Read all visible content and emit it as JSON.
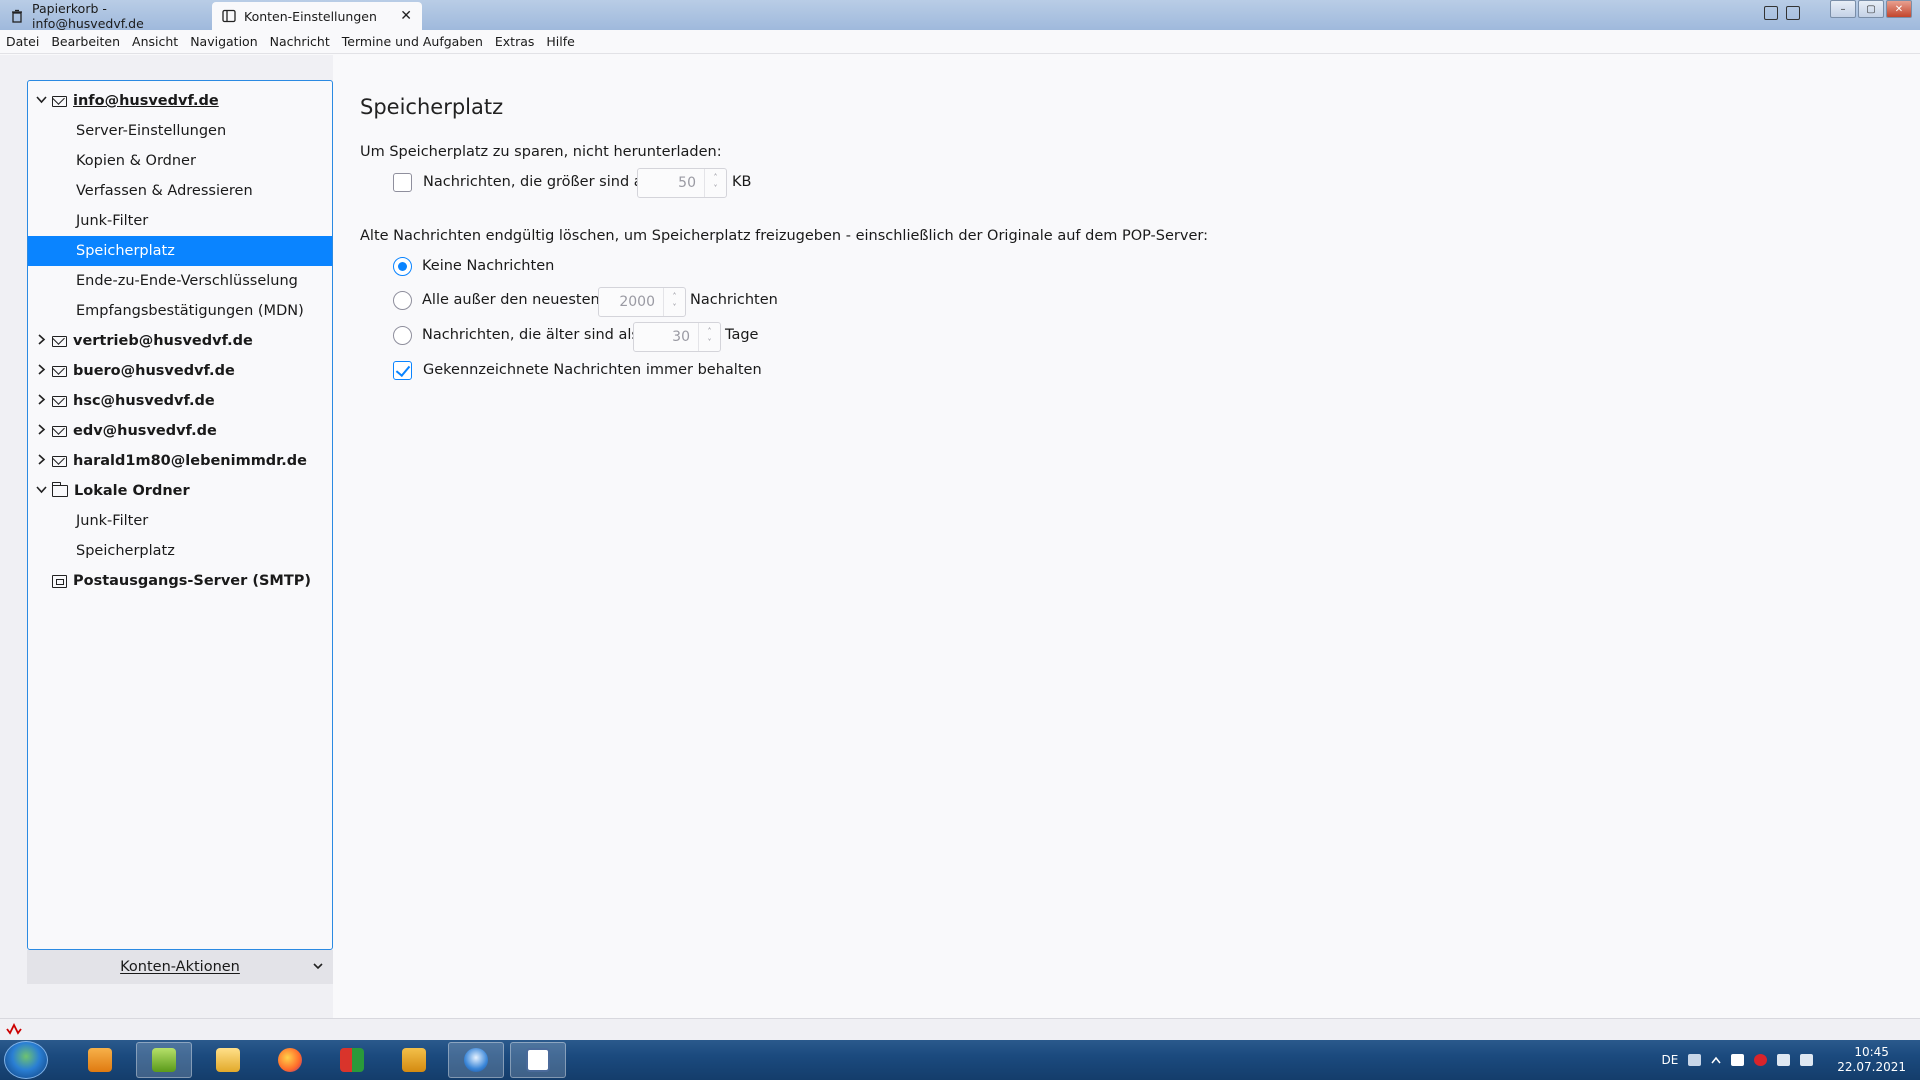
{
  "tabs": [
    {
      "label": "Papierkorb - info@husvedvf.de",
      "icon": "trash-icon"
    },
    {
      "label": "Konten-Einstellungen",
      "icon": "settings-tab-icon",
      "close": "✕"
    }
  ],
  "menu": [
    "Datei",
    "Bearbeiten",
    "Ansicht",
    "Navigation",
    "Nachricht",
    "Termine und Aufgaben",
    "Extras",
    "Hilfe"
  ],
  "tree": {
    "accounts": [
      {
        "label": "info@husvedvf.de",
        "expanded": true,
        "icon": "envelope-icon",
        "children": [
          "Server-Einstellungen",
          "Kopien & Ordner",
          "Verfassen & Adressieren",
          "Junk-Filter",
          "Speicherplatz",
          "Ende-zu-Ende-Verschlüsselung",
          "Empfangsbestätigungen (MDN)"
        ],
        "selected_child": "Speicherplatz"
      },
      {
        "label": "vertrieb@husvedvf.de",
        "expanded": false,
        "icon": "envelope-icon"
      },
      {
        "label": "buero@husvedvf.de",
        "expanded": false,
        "icon": "envelope-icon"
      },
      {
        "label": "hsc@husvedvf.de",
        "expanded": false,
        "icon": "envelope-icon"
      },
      {
        "label": "edv@husvedvf.de",
        "expanded": false,
        "icon": "envelope-icon"
      },
      {
        "label": "harald1m80@lebenimmdr.de",
        "expanded": false,
        "icon": "envelope-icon"
      },
      {
        "label": "Lokale Ordner",
        "expanded": true,
        "icon": "folder-icon",
        "children": [
          "Junk-Filter",
          "Speicherplatz"
        ]
      },
      {
        "label": "Postausgangs-Server (SMTP)",
        "icon": "smtp-icon"
      }
    ],
    "chevron_open": "⌄",
    "chevron_closed": "›"
  },
  "konten_aktionen": {
    "label": "Konten-Aktionen",
    "dropdown": "⌄"
  },
  "main": {
    "title": "Speicherplatz",
    "download_section": "Um Speicherplatz zu sparen, nicht herunterladen:",
    "size_limit": {
      "label": "Nachrichten, die größer sind als",
      "checked": false,
      "value": "50",
      "unit": "KB"
    },
    "delete_section": "Alte Nachrichten endgültig löschen, um Speicherplatz freizugeben - einschließlich der Originale auf dem POP-Server:",
    "options": {
      "none": {
        "label": "Keine Nachrichten",
        "selected": true
      },
      "all_except": {
        "label": "Alle außer den neuesten",
        "value": "2000",
        "unit": "Nachrichten"
      },
      "older_than": {
        "label": "Nachrichten, die älter sind als",
        "value": "30",
        "unit": "Tage"
      }
    },
    "keep_flagged": {
      "label": "Gekennzeichnete Nachrichten immer behalten",
      "checked": true
    }
  },
  "spinner": {
    "up": "˄",
    "down": "˅"
  },
  "tray": {
    "language": "DE",
    "time": "10:45",
    "date": "22.07.2021"
  },
  "colors": {
    "accent": "#0a84ff",
    "selected_row": "#0a84ff",
    "tree_border": "#2b8ae2"
  }
}
